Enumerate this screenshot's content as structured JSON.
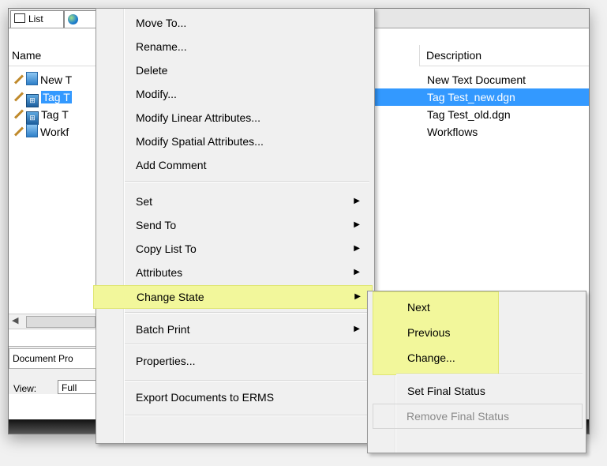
{
  "tabs": [
    {
      "label": "List",
      "icon": "list-icon"
    },
    {
      "label": "",
      "icon": "globe-icon"
    }
  ],
  "list": {
    "name_header": "Name",
    "description_header": "Description",
    "rows": [
      {
        "name": "New T",
        "description": "New Text Document",
        "selected": false
      },
      {
        "name": "Tag T",
        "description": "Tag Test_new.dgn",
        "selected": true
      },
      {
        "name": "Tag T",
        "description": "Tag Test_old.dgn",
        "selected": false
      },
      {
        "name": "Workf",
        "description": "Workflows",
        "selected": false
      }
    ]
  },
  "document_properties": {
    "tab_label": "Document Pro",
    "view_label": "View:",
    "view_value": "Full"
  },
  "context_menu": {
    "items": [
      {
        "label": "Move To...",
        "submenu": false
      },
      {
        "label": "Rename...",
        "submenu": false
      },
      {
        "label": "Delete",
        "submenu": false
      },
      {
        "label": "Modify...",
        "submenu": false
      },
      {
        "label": "Modify Linear Attributes...",
        "submenu": false
      },
      {
        "label": "Modify Spatial Attributes...",
        "submenu": false
      },
      {
        "label": "Add Comment",
        "submenu": false
      },
      {
        "label": "Set",
        "submenu": true
      },
      {
        "label": "Send To",
        "submenu": true
      },
      {
        "label": "Copy List To",
        "submenu": true
      },
      {
        "label": "Attributes",
        "submenu": true
      },
      {
        "label": "Change State",
        "submenu": true,
        "highlighted": true
      },
      {
        "label": "Batch Print",
        "submenu": true
      },
      {
        "label": "Properties...",
        "submenu": false
      },
      {
        "label": "Export Documents to ERMS",
        "submenu": false
      }
    ]
  },
  "submenu": {
    "items": [
      {
        "label": "Next",
        "disabled": false
      },
      {
        "label": "Previous",
        "disabled": false
      },
      {
        "label": "Change...",
        "disabled": false
      },
      {
        "label": "Set Final Status",
        "disabled": false
      },
      {
        "label": "Remove Final Status",
        "disabled": true
      }
    ]
  },
  "colors": {
    "selection": "#3399ff",
    "highlight": "#f2f79b",
    "menu_bg": "#f0f0f0"
  }
}
